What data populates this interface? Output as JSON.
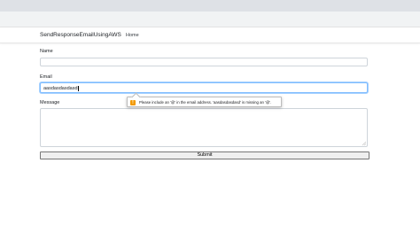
{
  "navbar": {
    "brand": "SendResponseEmailUsingAWS",
    "home_link": "Home"
  },
  "form": {
    "name_label": "Name",
    "name_value": "",
    "email_label": "Email",
    "email_value": "aasdasdasdasd",
    "message_label": "Message",
    "message_value": "",
    "submit_label": "Submit"
  },
  "validation_tooltip": {
    "icon": "warning-icon",
    "message": "Please include an '@' in the email address. 'aasdasdasdasd' is missing an '@'."
  },
  "colors": {
    "focus_border": "#80bdff",
    "warning": "#f29900"
  }
}
